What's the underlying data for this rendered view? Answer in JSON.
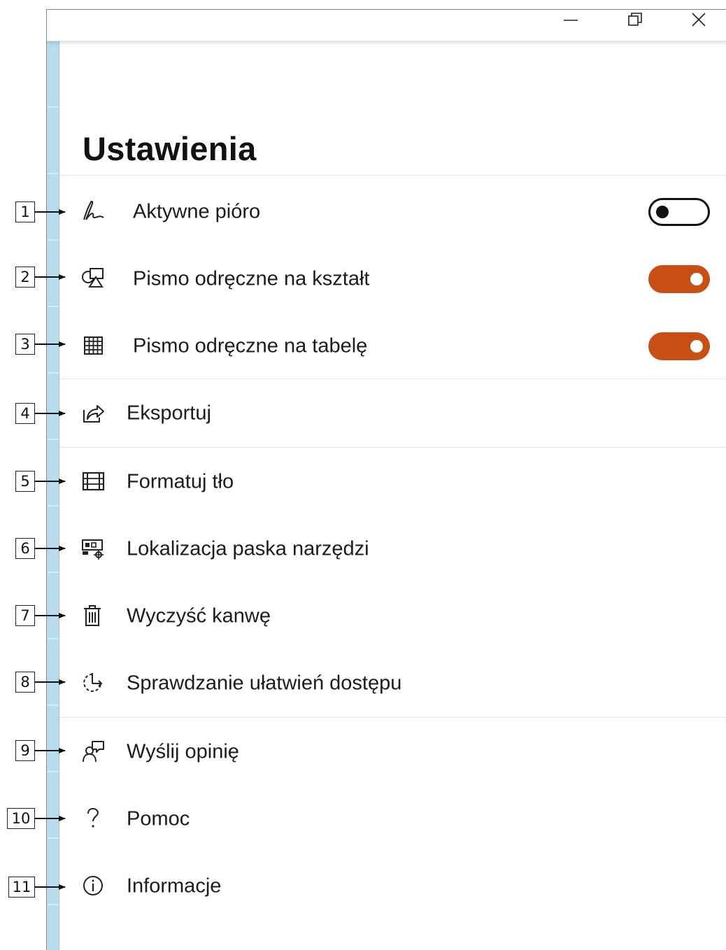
{
  "window": {
    "controls": {
      "minimize_icon": "minimize-icon",
      "maximize_icon": "restore-icon",
      "close_icon": "close-icon"
    }
  },
  "settings": {
    "title": "Ustawienia",
    "items": [
      {
        "icon": "pen-icon",
        "label": "Aktywne pióro",
        "toggle": "off"
      },
      {
        "icon": "shape-icon",
        "label": "Pismo odręczne na kształt",
        "toggle": "on"
      },
      {
        "icon": "table-icon",
        "label": "Pismo odręczne na tabelę",
        "toggle": "on"
      },
      {
        "icon": "share-icon",
        "label": "Eksportuj"
      },
      {
        "icon": "background-format-icon",
        "label": "Formatuj tło"
      },
      {
        "icon": "toolbar-location-icon",
        "label": "Lokalizacja paska narzędzi"
      },
      {
        "icon": "trash-icon",
        "label": "Wyczyść kanwę"
      },
      {
        "icon": "accessibility-check-icon",
        "label": "Sprawdzanie ułatwień dostępu"
      },
      {
        "icon": "feedback-icon",
        "label": "Wyślij opinię"
      },
      {
        "icon": "help-icon",
        "label": "Pomoc"
      },
      {
        "icon": "info-icon",
        "label": "Informacje"
      }
    ]
  },
  "callouts": [
    "1",
    "2",
    "3",
    "4",
    "5",
    "6",
    "7",
    "8",
    "9",
    "10",
    "11"
  ],
  "colors": {
    "toggle_on": "#c74f14",
    "strip": "#b9dcea"
  }
}
